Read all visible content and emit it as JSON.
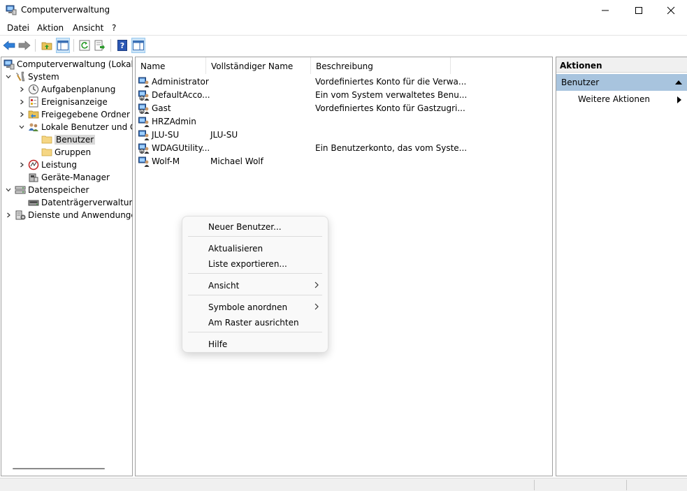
{
  "window": {
    "title": "Computerverwaltung"
  },
  "menu": [
    "Datei",
    "Aktion",
    "Ansicht",
    "?"
  ],
  "tree": [
    {
      "label": "Computerverwaltung (Lokal)",
      "icon": "computer-management-icon",
      "expanded": true
    },
    {
      "label": "System",
      "icon": "system-tools-icon",
      "expanded": true
    },
    {
      "label": "Aufgabenplanung",
      "icon": "clock-icon",
      "expanded": false
    },
    {
      "label": "Ereignisanzeige",
      "icon": "event-viewer-icon",
      "expanded": false
    },
    {
      "label": "Freigegebene Ordner",
      "icon": "shared-folder-icon",
      "expanded": false
    },
    {
      "label": "Lokale Benutzer und Gruppen",
      "icon": "users-icon",
      "expanded": true
    },
    {
      "label": "Benutzer",
      "icon": "folder-icon",
      "selected": true
    },
    {
      "label": "Gruppen",
      "icon": "folder-icon"
    },
    {
      "label": "Leistung",
      "icon": "performance-icon",
      "expanded": false
    },
    {
      "label": "Geräte-Manager",
      "icon": "device-manager-icon"
    },
    {
      "label": "Datenspeicher",
      "icon": "storage-icon",
      "expanded": true
    },
    {
      "label": "Datenträgerverwaltung",
      "icon": "disk-management-icon"
    },
    {
      "label": "Dienste und Anwendungen",
      "icon": "services-icon",
      "expanded": false
    }
  ],
  "list": {
    "columns": [
      "Name",
      "Vollständiger Name",
      "Beschreibung"
    ],
    "rows": [
      {
        "name": "Administrator",
        "fullname": "",
        "description": "Vordefiniertes Konto für die Verwa..."
      },
      {
        "name": "DefaultAcco...",
        "fullname": "",
        "description": "Ein vom System verwaltetes Benu..."
      },
      {
        "name": "Gast",
        "fullname": "",
        "description": "Vordefiniertes Konto für Gastzugri..."
      },
      {
        "name": "HRZAdmin",
        "fullname": "",
        "description": ""
      },
      {
        "name": "JLU-SU",
        "fullname": "JLU-SU",
        "description": ""
      },
      {
        "name": "WDAGUtility...",
        "fullname": "",
        "description": "Ein Benutzerkonto, das vom Syste..."
      },
      {
        "name": "Wolf-M",
        "fullname": "Michael Wolf",
        "description": ""
      }
    ]
  },
  "actions": {
    "header": "Aktionen",
    "section": "Benutzer",
    "items": [
      "Weitere Aktionen"
    ]
  },
  "context_menu": [
    {
      "label": "Neuer Benutzer..."
    },
    {
      "label": "Aktualisieren"
    },
    {
      "label": "Liste exportieren..."
    },
    {
      "label": "Ansicht",
      "submenu": true
    },
    {
      "label": "Symbole anordnen",
      "submenu": true
    },
    {
      "label": "Am Raster ausrichten"
    },
    {
      "label": "Hilfe"
    }
  ]
}
